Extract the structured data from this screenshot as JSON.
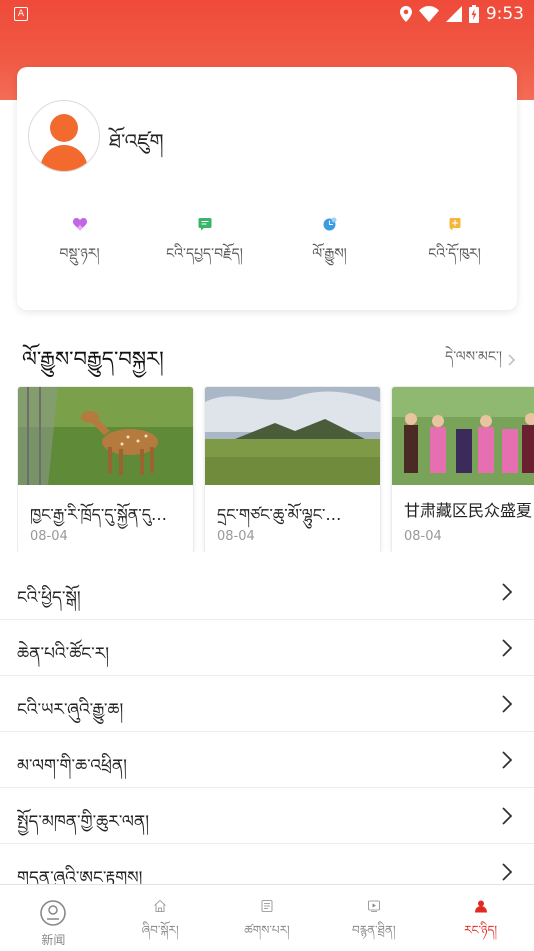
{
  "status_bar": {
    "time": "9:53",
    "left_icon": "A",
    "icons": [
      "location-icon",
      "wifi-icon",
      "signal-icon",
      "battery-icon"
    ]
  },
  "colors": {
    "header_red": "#ef4a3a",
    "accent_red": "#e32a22",
    "avatar_orange": "#f26a2e"
  },
  "profile": {
    "username": "ཐོ་འཛུག"
  },
  "quick_actions": [
    {
      "id": "likes",
      "label": "བསྡུ་ཉར།",
      "icon": "heart-icon",
      "color": "#c266e6"
    },
    {
      "id": "comments",
      "label": "ངའི་དཔྱད་བརྗོད།",
      "icon": "message-icon",
      "color": "#3ab36b"
    },
    {
      "id": "history",
      "label": "ལོ་རྒྱུས།",
      "icon": "clock-icon",
      "color": "#3a9ce3"
    },
    {
      "id": "subscriptions",
      "label": "ངའི་དོ་ཁུར།",
      "icon": "add-subscription-icon",
      "color": "#f4b73b"
    }
  ],
  "history_section": {
    "title": "ལོ་རྒྱུས་བརྒྱུད་བསྐྱར།",
    "more_label": "དེ་ལས་མང་།"
  },
  "history_cards": [
    {
      "title": "ཁྱང་རྒྱ་རི་ཁྲོད་དུ་སྐྱོན་དུ…",
      "date": "08-04",
      "image": "deer-photo"
    },
    {
      "title": "དྲང་གཙང་ཆུ་མོ་ལྷུང་…",
      "date": "08-04",
      "image": "grassland-photo"
    },
    {
      "title": "甘肃藏区民众盛夏",
      "date": "08-04",
      "image": "festival-photo"
    }
  ],
  "menu": [
    {
      "id": "feedback",
      "label": "ངའི་ཕྱིད་སྒོ།"
    },
    {
      "id": "settings",
      "label": "ཆེན་པའི་ཚོང་ར།"
    },
    {
      "id": "about",
      "label": "ངའི་ཡར་ཞུའི་རྒྱུ་ཆ།"
    },
    {
      "id": "clear-cache",
      "label": "མ་ལག་གི་ཆ་འཕྲིན།"
    },
    {
      "id": "share",
      "label": "སྤྱོད་མཁན་གྱི་ཆུར་ལན།"
    },
    {
      "id": "privacy",
      "label": "གདན་ཞུའི་ཨང་རྟགས།"
    }
  ],
  "tabs": [
    {
      "id": "news",
      "label": "新闻",
      "icon": "news-icon",
      "active": false
    },
    {
      "id": "home",
      "label": "ཞིབ་སྐོར།",
      "icon": "home-icon",
      "active": false
    },
    {
      "id": "articles",
      "label": "ཚགས་པར།",
      "icon": "document-icon",
      "active": false
    },
    {
      "id": "video",
      "label": "བརྙན་ཐྲིན།",
      "icon": "video-icon",
      "active": false
    },
    {
      "id": "me",
      "label": "རང་ཉིད།",
      "icon": "person-icon",
      "active": true
    }
  ]
}
